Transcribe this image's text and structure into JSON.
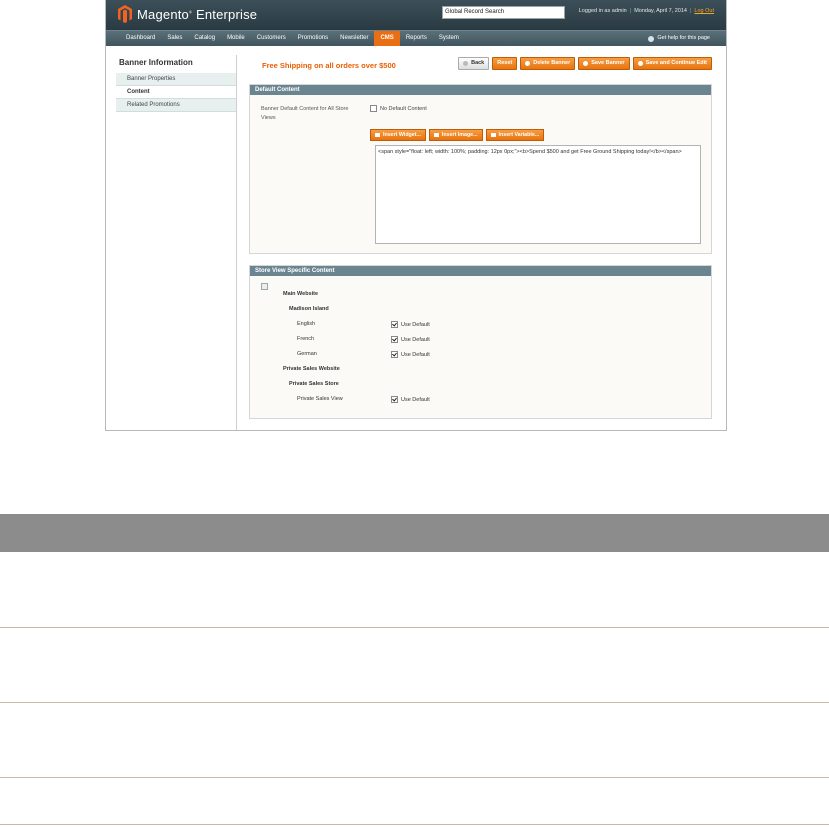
{
  "header": {
    "logo_text": "Magento",
    "logo_text2": "Enterprise",
    "search_value": "Global Record Search",
    "user_text": "Logged in as admin",
    "date_text": "Monday, April 7, 2014",
    "logout_label": "Log Out"
  },
  "nav": {
    "items": [
      "Dashboard",
      "Sales",
      "Catalog",
      "Mobile",
      "Customers",
      "Promotions",
      "Newsletter",
      "CMS",
      "Reports",
      "System"
    ],
    "active_index": 7,
    "help_label": "Get help for this page"
  },
  "sidebar": {
    "title": "Banner Information",
    "items": [
      "Banner Properties",
      "Content",
      "Related Promotions"
    ],
    "active_index": 1
  },
  "main": {
    "title": "Free Shipping on all orders over $500",
    "buttons": {
      "back": "Back",
      "reset": "Reset",
      "delete": "Delete Banner",
      "save": "Save Banner",
      "save_continue": "Save and Continue Edit"
    },
    "default_content": {
      "legend": "Default Content",
      "field_label": "Banner Default Content for All Store Views",
      "no_default_label": "No Default Content",
      "insert_widget": "Insert Widget...",
      "insert_image": "Insert Image...",
      "insert_variable": "Insert Variable...",
      "editor_text": "<span style=\"float: left; width: 100%; padding: 12px 0px;\"><b>Spend $500 and get Free Ground Shipping today!</b></span>"
    },
    "store_view": {
      "legend": "Store View Specific Content",
      "main_website": "Main Website",
      "madison_island": "Madison Island",
      "english": "English",
      "french": "French",
      "german": "German",
      "private_sales_website": "Private Sales Website",
      "private_sales_store": "Private Sales Store",
      "private_sales_view": "Private Sales View",
      "use_default": "Use Default"
    }
  },
  "colors": {
    "accent": "#ea6e13",
    "header_bg": "#2f4048",
    "section_head": "#6b8590",
    "table_head": "#8c8c8c"
  }
}
